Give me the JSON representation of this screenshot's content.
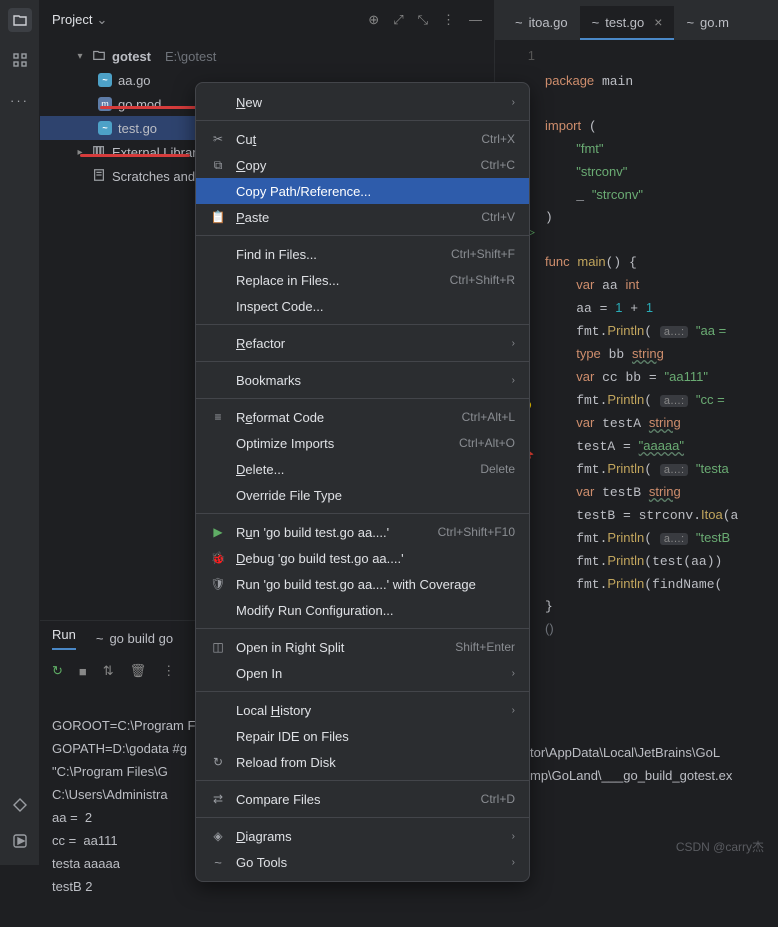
{
  "project": {
    "title": "Project",
    "root": {
      "name": "gotest",
      "path": "E:\\gotest"
    },
    "files": {
      "aa": "aa.go",
      "gomod": "go.mod",
      "test": "test.go"
    },
    "external": "External Librarie",
    "scratches": "Scratches and C"
  },
  "editor_tabs": {
    "itoa": "itoa.go",
    "test": "test.go",
    "gom": "go.m"
  },
  "gutter": {
    "line1": "1"
  },
  "code": {
    "l1": "package main",
    "l3": "import (",
    "l4": "    \"fmt\"",
    "l5": "    \"strconv\"",
    "l6": "    _ \"strconv\"",
    "l7": ")",
    "l9": "func main() {",
    "l10": "    var aa int",
    "l11": "    aa = 1 + 1",
    "l12a": "    fmt.Println(",
    "l12h": "a…:",
    "l12b": "\"aa = ",
    "l13": "    type bb string",
    "l14": "    var cc bb = \"aa111\"",
    "l15a": "    fmt.Println( ",
    "l15h": "a…:",
    "l15b": "\"cc = ",
    "l16": "    var testA string",
    "l17": "    testA = \"aaaaa\"",
    "l18a": "    fmt.Println( ",
    "l18h": "a…:",
    "l18b": "\"testa",
    "l19": "    var testB string",
    "l20": "    testB = strconv.Itoa(a",
    "l21a": "    fmt.Println( ",
    "l21h": "a…:",
    "l21b": "\"testB",
    "l22": "    fmt.Println(test(aa))",
    "l23": "    fmt.Println(findName(",
    "l24": "}",
    "l25": "()"
  },
  "context_menu": {
    "new": "New",
    "cut": "Cut",
    "cut_key": "Ctrl+X",
    "copy": "Copy",
    "copy_key": "Ctrl+C",
    "copy_path": "Copy Path/Reference...",
    "paste": "Paste",
    "paste_key": "Ctrl+V",
    "find_in_files": "Find in Files...",
    "find_key": "Ctrl+Shift+F",
    "replace_in_files": "Replace in Files...",
    "replace_key": "Ctrl+Shift+R",
    "inspect": "Inspect Code...",
    "refactor": "Refactor",
    "bookmarks": "Bookmarks",
    "reformat": "Reformat Code",
    "reformat_key": "Ctrl+Alt+L",
    "optimize": "Optimize Imports",
    "optimize_key": "Ctrl+Alt+O",
    "delete": "Delete...",
    "delete_key": "Delete",
    "override": "Override File Type",
    "run": "Run 'go build test.go aa....'",
    "run_key": "Ctrl+Shift+F10",
    "debug": "Debug 'go build test.go aa....'",
    "coverage": "Run 'go build test.go aa....' with Coverage",
    "modify": "Modify Run Configuration...",
    "open_split": "Open in Right Split",
    "open_split_key": "Shift+Enter",
    "open_in": "Open In",
    "local_history": "Local History",
    "repair": "Repair IDE on Files",
    "reload": "Reload from Disk",
    "compare": "Compare Files",
    "compare_key": "Ctrl+D",
    "diagrams": "Diagrams",
    "go_tools": "Go Tools"
  },
  "run_panel": {
    "tab": "Run",
    "config": "go build go",
    "out1": "GOROOT=C:\\Program F",
    "out2": "GOPATH=D:\\godata #g",
    "out3": "\"C:\\Program Files\\G",
    "out4": "C:\\Users\\Administra",
    "out3b": "tor\\AppData\\Local\\JetBrains\\GoL",
    "out4b": "mp\\GoLand\\___go_build_gotest.ex",
    "out5": "aa =  2",
    "out6": "cc =  aa111",
    "out7": "testa aaaaa",
    "out8": "testB 2"
  },
  "watermark": "CSDN @carry杰"
}
